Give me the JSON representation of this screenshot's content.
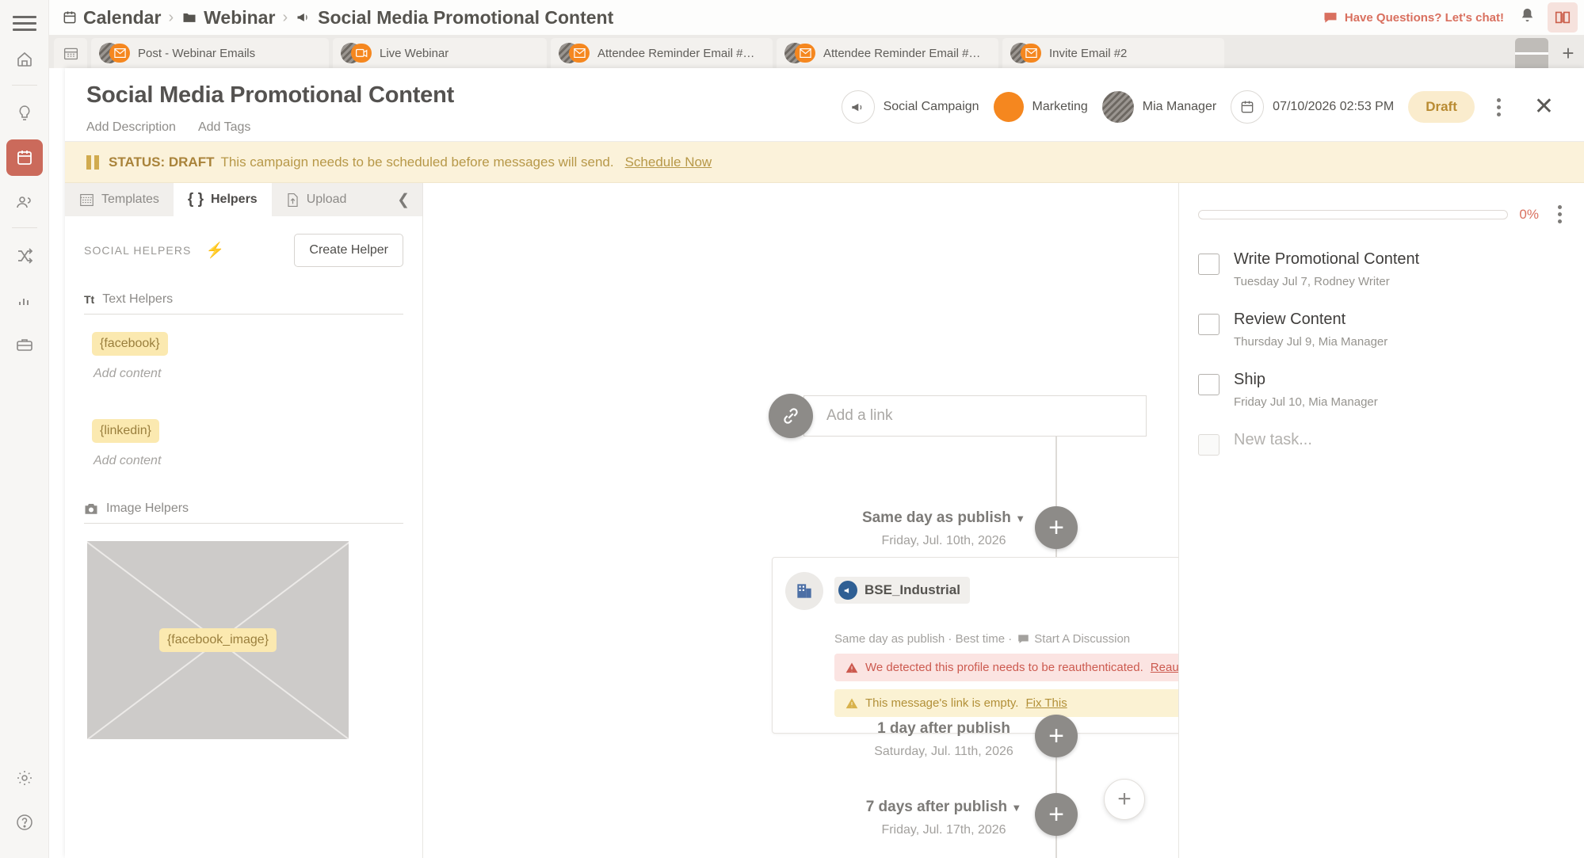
{
  "rail": {
    "menu_icon": "hamburger-icon",
    "items": [
      {
        "icon": "home-icon",
        "name": "home"
      },
      {
        "icon": "lightbulb-icon",
        "name": "ideas"
      },
      {
        "icon": "calendar-icon",
        "name": "calendar",
        "active": true
      },
      {
        "icon": "people-icon",
        "name": "team"
      },
      {
        "icon": "shuffle-icon",
        "name": "workflows"
      },
      {
        "icon": "chart-icon",
        "name": "analytics"
      },
      {
        "icon": "briefcase-icon",
        "name": "assets"
      }
    ],
    "bottom": [
      {
        "icon": "gear-icon",
        "name": "settings"
      },
      {
        "icon": "help-icon",
        "name": "help"
      }
    ]
  },
  "topbar": {
    "breadcrumb": [
      {
        "label": "Calendar",
        "icon": "calendar-icon"
      },
      {
        "label": "Webinar",
        "icon": "folder-icon"
      },
      {
        "label": "Social Media Promotional Content",
        "icon": "megaphone-icon"
      }
    ],
    "separator": "›",
    "chat_label": "Have Questions? Let's chat!",
    "chat_icon": "chat-bubble-icon",
    "bell_icon": "bell-icon",
    "book_icon": "book-icon",
    "chat_color": "#d9705f"
  },
  "tabbar": {
    "calendar_icon": "calendar-grid-icon",
    "tabs": [
      {
        "label": "Post - Webinar Emails",
        "badge": "envelope-icon"
      },
      {
        "label": "Live Webinar",
        "badge": "video-icon"
      },
      {
        "label": "Attendee Reminder Email #…",
        "badge": "envelope-icon"
      },
      {
        "label": "Attendee Reminder Email #…",
        "badge": "envelope-icon"
      },
      {
        "label": "Invite Email #2",
        "badge": "envelope-icon"
      }
    ],
    "menu_icon": "list-view-icon",
    "add_icon": "plus-icon"
  },
  "modal": {
    "title": "Social Media Promotional Content",
    "add_description": "Add Description",
    "add_tags": "Add Tags",
    "meta": {
      "type_label": "Social Campaign",
      "type_icon": "megaphone-icon",
      "color_label": "Marketing",
      "color_hex": "#f5871f",
      "owner": "Mia Manager",
      "date": "07/10/2026 02:53 PM",
      "date_icon": "calendar-icon",
      "status": "Draft"
    },
    "kebab_icon": "kebab-menu-icon",
    "close_icon": "close-icon"
  },
  "banner": {
    "icon": "pause-icon",
    "status_label": "STATUS: DRAFT",
    "message": "This campaign needs to be scheduled before messages will send.",
    "action": "Schedule Now",
    "bg": "#fbf2da",
    "fg": "#b79848"
  },
  "helpers": {
    "tabs": [
      {
        "label": "Templates",
        "icon": "template-icon",
        "active": false
      },
      {
        "label": "Helpers",
        "icon": "braces-icon",
        "active": true
      },
      {
        "label": "Upload",
        "icon": "upload-icon",
        "active": false
      }
    ],
    "collapse_icon": "chevron-left-icon",
    "section_label": "SOCIAL HELPERS",
    "bolt_icon": "bolt-icon",
    "create_button": "Create Helper",
    "text_section": {
      "label": "Text Helpers",
      "glyph": "Tt"
    },
    "text_helpers": [
      {
        "token": "{facebook}",
        "placeholder": "Add content"
      },
      {
        "token": "{linkedin}",
        "placeholder": "Add content"
      }
    ],
    "image_section": {
      "label": "Image Helpers",
      "icon": "camera-icon"
    },
    "image_helpers": [
      {
        "token": "{facebook_image}"
      }
    ]
  },
  "center": {
    "link_placeholder": "Add a link",
    "link_icon": "link-icon",
    "plus_icon": "plus-icon",
    "timeline": [
      {
        "when": "Same day as publish",
        "caret": true,
        "date": "Friday, Jul. 10th, 2026"
      },
      {
        "when": "1 day after publish",
        "caret": false,
        "date": "Saturday, Jul. 11th, 2026"
      },
      {
        "when": "7 days after publish",
        "caret": true,
        "date": "Friday, Jul. 17th, 2026"
      }
    ],
    "message_card": {
      "avatar_icon": "building-icon",
      "profile_icon": "megaphone-icon",
      "profile_name": "BSE_Industrial",
      "meta_left": "Same day as publish · Best time ·",
      "discussion_icon": "chat-bubble-icon",
      "discussion_label": "Start A Discussion",
      "kebab_icon": "kebab-menu-icon",
      "alerts": [
        {
          "level": "red",
          "icon": "warning-icon",
          "text": "We detected this profile needs to be reauthenticated.",
          "link": "Reauthenticate this Profile."
        },
        {
          "level": "yellow",
          "icon": "warning-icon",
          "text": "This message's link is empty.",
          "link": "Fix This"
        }
      ]
    },
    "fab_icon": "plus-icon"
  },
  "tasks": {
    "progress_pct": "0%",
    "kebab_icon": "kebab-menu-icon",
    "items": [
      {
        "name": "Write Promotional Content",
        "meta": "Tuesday Jul 7,  Rodney Writer",
        "done": false
      },
      {
        "name": "Review Content",
        "meta": "Thursday Jul 9,  Mia Manager",
        "done": false
      },
      {
        "name": "Ship",
        "meta": "Friday Jul 10,  Mia Manager",
        "done": false
      }
    ],
    "new_task_placeholder": "New task..."
  }
}
